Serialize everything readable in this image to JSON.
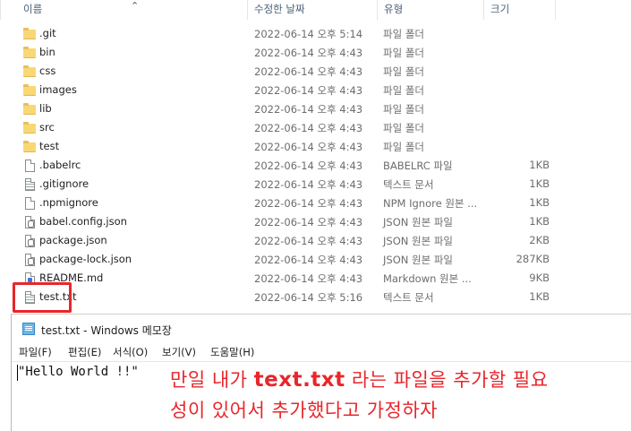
{
  "explorer": {
    "columns": {
      "name": "이름",
      "date": "수정한 날짜",
      "type": "유형",
      "size": "크기"
    },
    "sort_indicator_icon": "chevron-down-icon",
    "files": [
      {
        "name": ".git",
        "date": "2022-06-14 오후 5:14",
        "type": "파일 폴더",
        "size": "",
        "icon": "folder-icon"
      },
      {
        "name": "bin",
        "date": "2022-06-14 오후 4:43",
        "type": "파일 폴더",
        "size": "",
        "icon": "folder-icon"
      },
      {
        "name": "css",
        "date": "2022-06-14 오후 4:43",
        "type": "파일 폴더",
        "size": "",
        "icon": "folder-icon"
      },
      {
        "name": "images",
        "date": "2022-06-14 오후 4:43",
        "type": "파일 폴더",
        "size": "",
        "icon": "folder-icon"
      },
      {
        "name": "lib",
        "date": "2022-06-14 오후 4:43",
        "type": "파일 폴더",
        "size": "",
        "icon": "folder-icon"
      },
      {
        "name": "src",
        "date": "2022-06-14 오후 4:43",
        "type": "파일 폴더",
        "size": "",
        "icon": "folder-icon"
      },
      {
        "name": "test",
        "date": "2022-06-14 오후 4:43",
        "type": "파일 폴더",
        "size": "",
        "icon": "folder-icon"
      },
      {
        "name": ".babelrc",
        "date": "2022-06-14 오후 4:43",
        "type": "BABELRC 파일",
        "size": "1KB",
        "icon": "file-icon"
      },
      {
        "name": ".gitignore",
        "date": "2022-06-14 오후 4:43",
        "type": "텍스트 문서",
        "size": "1KB",
        "icon": "text-file-icon"
      },
      {
        "name": ".npmignore",
        "date": "2022-06-14 오후 4:43",
        "type": "NPM Ignore 원본 ...",
        "size": "1KB",
        "icon": "file-icon"
      },
      {
        "name": "babel.config.json",
        "date": "2022-06-14 오후 4:43",
        "type": "JSON 원본 파일",
        "size": "1KB",
        "icon": "json-file-icon"
      },
      {
        "name": "package.json",
        "date": "2022-06-14 오후 4:43",
        "type": "JSON 원본 파일",
        "size": "2KB",
        "icon": "json-file-icon"
      },
      {
        "name": "package-lock.json",
        "date": "2022-06-14 오후 4:43",
        "type": "JSON 원본 파일",
        "size": "287KB",
        "icon": "json-file-icon"
      },
      {
        "name": "README.md",
        "date": "2022-06-14 오후 4:43",
        "type": "Markdown 원본 ...",
        "size": "9KB",
        "icon": "markdown-file-icon"
      },
      {
        "name": "test.txt",
        "date": "2022-06-14 오후 5:16",
        "type": "텍스트 문서",
        "size": "1KB",
        "icon": "text-file-icon"
      }
    ],
    "highlight_color": "#e8262a"
  },
  "notepad": {
    "title": "test.txt - Windows 메모장",
    "menu": [
      "파일(F)",
      "편집(E)",
      "서식(O)",
      "보기(V)",
      "도움말(H)"
    ],
    "content": "\"Hello World !!\""
  },
  "annotation": {
    "part1": "만일 내가 ",
    "bold": "text.txt",
    "part2": " 라는 파일을 추가할 필요",
    "line2": "성이 있어서 추가했다고 가정하자",
    "color": "#e8262a"
  }
}
